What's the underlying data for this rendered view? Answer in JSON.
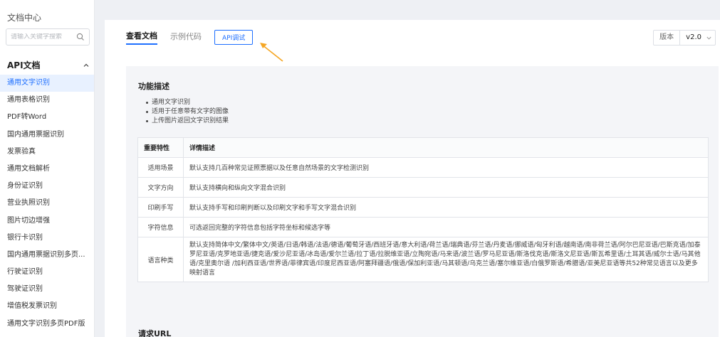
{
  "sidebar": {
    "title": "文档中心",
    "search_placeholder": "请输入关键字搜索",
    "section": "API文档",
    "items": [
      {
        "label": "通用文字识别",
        "active": true
      },
      {
        "label": "通用表格识别"
      },
      {
        "label": "PDF转Word"
      },
      {
        "label": "国内通用票据识别"
      },
      {
        "label": "发票验真"
      },
      {
        "label": "通用文档解析"
      },
      {
        "label": "身份证识别"
      },
      {
        "label": "营业执照识别"
      },
      {
        "label": "图片切边增强"
      },
      {
        "label": "银行卡识别"
      },
      {
        "label": "国内通用票据识别多页..."
      },
      {
        "label": "行驶证识别"
      },
      {
        "label": "驾驶证识别"
      },
      {
        "label": "增值税发票识别"
      },
      {
        "label": "通用文字识别多页PDF版"
      }
    ]
  },
  "tabs": {
    "doc": "查看文档",
    "code": "示例代码",
    "debug": "API调试"
  },
  "version": {
    "label": "版本",
    "value": "v2.0"
  },
  "content": {
    "func_heading": "功能描述",
    "bullets": [
      "通用文字识别",
      "适用于任意带有文字的图像",
      "上传图片返回文字识别结果"
    ],
    "table": {
      "headers": [
        "重要特性",
        "详情描述"
      ],
      "rows": [
        [
          "适用场景",
          "默认支持几百种常见证照票据以及任意自然场景的文字检测识别"
        ],
        [
          "文字方向",
          "默认支持横向和纵向文字混合识别"
        ],
        [
          "印刷手写",
          "默认支持手写和印刷判断以及印刷文字和手写文字混合识别"
        ],
        [
          "字符信息",
          "可选返回完整的字符信息包括字符坐标和候选字等"
        ],
        [
          "语言种类",
          "默认支持简体中文/繁体中文/英语/日语/韩语/法语/德语/葡萄牙语/西班牙语/意大利语/荷兰语/瑞典语/芬兰语/丹麦语/挪威语/匈牙利语/越南语/南非荷兰语/阿尔巴尼亚语/巴斯克语/加泰罗尼亚语/克罗地亚语/捷克语/爱沙尼亚语/冰岛语/爱尔兰语/拉丁语/拉脱维亚语/立陶宛语/马来语/波兰语/罗马尼亚语/斯洛伐克语/斯洛文尼亚语/斯瓦希里语/土耳其语/威尔士语/马其他语/克里奥尔语 /加利西亚语/世界语/菲律宾语/印度尼西亚语/阿塞拜疆语/俄语/保加利亚语/马其顿语/乌克兰语/塞尔维亚语/白俄罗斯语/希腊语/亚美尼亚语等共52种常见语言以及更多映射语言"
        ]
      ]
    },
    "url_heading": "请求URL"
  },
  "colors": {
    "accent": "#1e6fff",
    "arrow": "#f5a623"
  }
}
